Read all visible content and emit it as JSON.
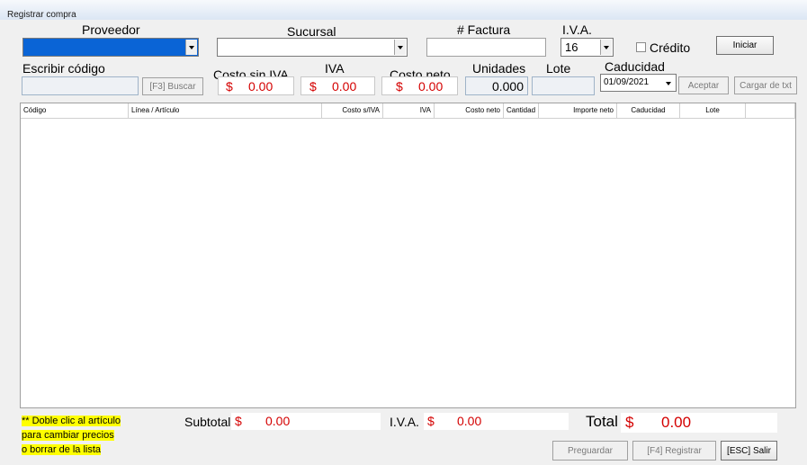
{
  "window": {
    "title": "Registrar compra"
  },
  "header": {
    "proveedor_label": "Proveedor",
    "sucursal_label": "Sucursal",
    "factura_label": "# Factura",
    "iva_label": "I.V.A.",
    "iva_value": "16",
    "credito_label": "Crédito",
    "iniciar_label": "Iniciar"
  },
  "entry": {
    "codigo_label": "Escribir código",
    "buscar_label": "[F3] Buscar",
    "costo_sin_iva_label": "Costo sin IVA",
    "iva_label": "IVA",
    "costo_neto_label": "Costo neto",
    "unidades_label": "Unidades",
    "lote_label": "Lote",
    "caducidad_label": "Caducidad",
    "currency": "$",
    "costo_sin_iva_value": "0.00",
    "iva_value": "0.00",
    "costo_neto_value": "0.00",
    "unidades_value": "0.000",
    "caducidad_value": "01/09/2021",
    "aceptar_label": "Aceptar",
    "cargar_label": "Cargar de txt"
  },
  "table": {
    "columns": [
      "Código",
      "Línea / Artículo",
      "Costo s/IVA",
      "IVA",
      "Costo neto",
      "Cantidad",
      "Importe neto",
      "Caducidad",
      "Lote"
    ],
    "rows": []
  },
  "footer": {
    "note_line1": "** Doble clic al artículo",
    "note_line2": "para cambiar precios",
    "note_line3": "o borrar de la lista",
    "subtotal_label": "Subtotal",
    "subtotal_value": "0.00",
    "iva_label": "I.V.A.",
    "iva_value": "0.00",
    "total_label": "Total",
    "total_value": "0.00",
    "currency": "$",
    "preguardar_label": "Preguardar",
    "registrar_label": "[F4] Registrar",
    "salir_label": "[ESC] Salir"
  }
}
